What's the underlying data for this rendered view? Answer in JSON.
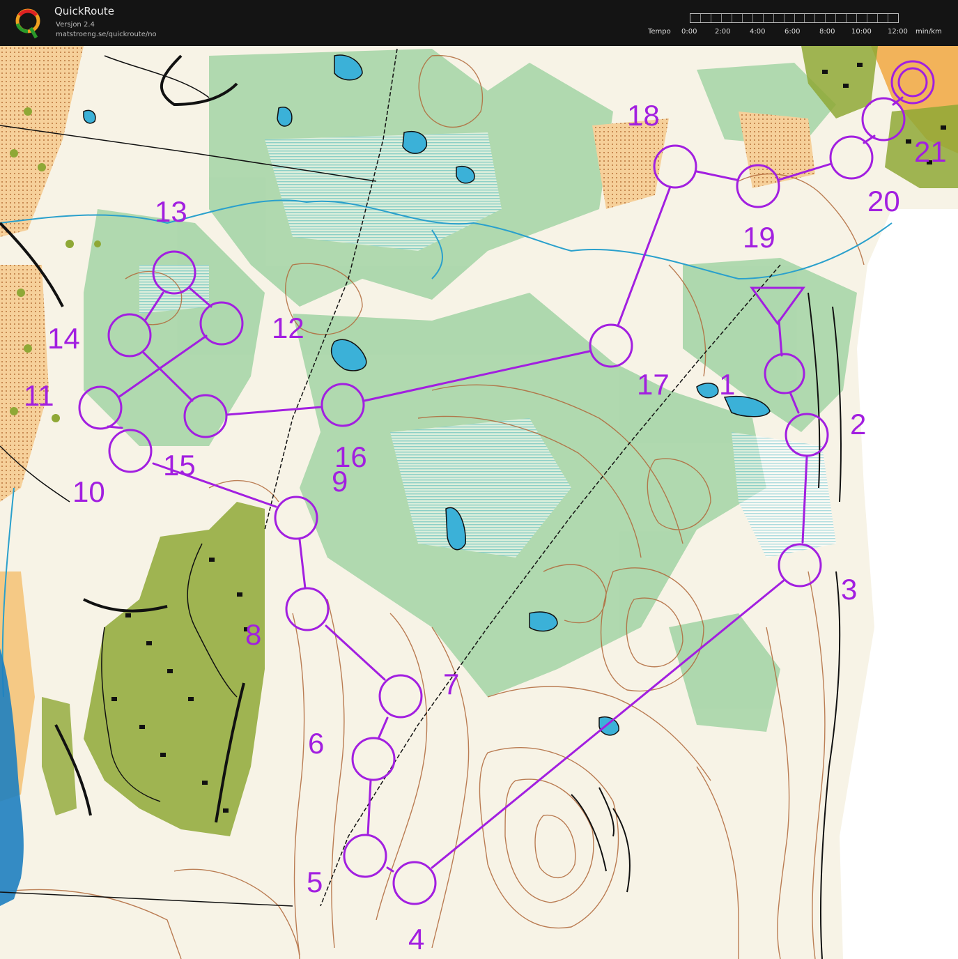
{
  "app": {
    "title": "QuickRoute",
    "version": "Versjon 2.4",
    "url": "matstroeng.se/quickroute/no"
  },
  "tempo": {
    "label": "Tempo",
    "ticks": [
      "0:00",
      "2:00",
      "4:00",
      "6:00",
      "8:00",
      "10:00",
      "12:00"
    ],
    "unit": "min/km"
  },
  "colors": {
    "course": "#a21fe0",
    "forest_green": "#9fd3a0",
    "open_land": "#f6c87c",
    "settlement": "#8fa630",
    "contours": "#a05a2c",
    "water": "#1ea0d0"
  },
  "course": {
    "controls": [
      {
        "number": "1"
      },
      {
        "number": "2"
      },
      {
        "number": "3"
      },
      {
        "number": "4"
      },
      {
        "number": "5"
      },
      {
        "number": "6"
      },
      {
        "number": "7"
      },
      {
        "number": "8"
      },
      {
        "number": "9"
      },
      {
        "number": "10"
      },
      {
        "number": "11"
      },
      {
        "number": "12"
      },
      {
        "number": "13"
      },
      {
        "number": "14"
      },
      {
        "number": "15"
      },
      {
        "number": "16"
      },
      {
        "number": "17"
      },
      {
        "number": "18"
      },
      {
        "number": "19"
      },
      {
        "number": "20"
      },
      {
        "number": "21"
      }
    ]
  }
}
